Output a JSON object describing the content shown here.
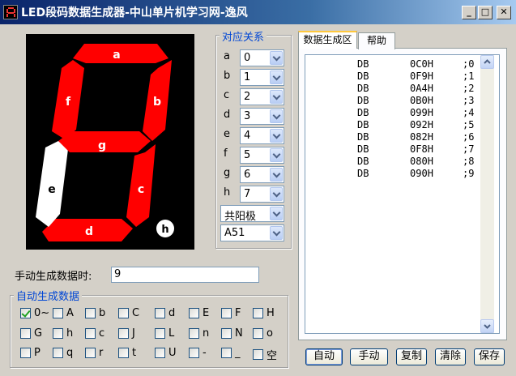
{
  "window": {
    "title": "LED段码数据生成器-中山单片机学习网-逸风",
    "controls": {
      "minimize": "_",
      "maximize": "□",
      "close": "✕"
    }
  },
  "display": {
    "segments": {
      "a": "a",
      "b": "b",
      "c": "c",
      "d": "d",
      "e": "e",
      "f": "f",
      "g": "g",
      "h": "h"
    },
    "colors": {
      "on": "#ff0000",
      "off": "#ffffff",
      "background": "#000000"
    },
    "unlit_segment": "e"
  },
  "mapping": {
    "label": "对应关系",
    "rows": [
      {
        "letter": "a",
        "value": "0"
      },
      {
        "letter": "b",
        "value": "1"
      },
      {
        "letter": "c",
        "value": "2"
      },
      {
        "letter": "d",
        "value": "3"
      },
      {
        "letter": "e",
        "value": "4"
      },
      {
        "letter": "f",
        "value": "5"
      },
      {
        "letter": "g",
        "value": "6"
      },
      {
        "letter": "h",
        "value": "7"
      }
    ],
    "type_value": "共阳极",
    "format_value": "A51"
  },
  "tabs": [
    {
      "label": "数据生成区",
      "active": true
    },
    {
      "label": "帮助",
      "active": false
    }
  ],
  "output_lines": [
    "DB       0C0H     ;0",
    "DB       0F9H     ;1",
    "DB       0A4H     ;2",
    "DB       0B0H     ;3",
    "DB       099H     ;4",
    "DB       092H     ;5",
    "DB       082H     ;6",
    "DB       0F8H     ;7",
    "DB       080H     ;8",
    "DB       090H     ;9"
  ],
  "manual": {
    "label": "手动生成数据时:",
    "value": "9"
  },
  "auto": {
    "label": "自动生成数据",
    "checkboxes": [
      {
        "label": "0~",
        "checked": true
      },
      {
        "label": "A",
        "checked": false
      },
      {
        "label": "b",
        "checked": false
      },
      {
        "label": "C",
        "checked": false
      },
      {
        "label": "d",
        "checked": false
      },
      {
        "label": "E",
        "checked": false
      },
      {
        "label": "F",
        "checked": false
      },
      {
        "label": "H",
        "checked": false
      },
      {
        "label": "G",
        "checked": false
      },
      {
        "label": "h",
        "checked": false
      },
      {
        "label": "c",
        "checked": false
      },
      {
        "label": "J",
        "checked": false
      },
      {
        "label": "L",
        "checked": false
      },
      {
        "label": "n",
        "checked": false
      },
      {
        "label": "N",
        "checked": false
      },
      {
        "label": "o",
        "checked": false
      },
      {
        "label": "P",
        "checked": false
      },
      {
        "label": "q",
        "checked": false
      },
      {
        "label": "r",
        "checked": false
      },
      {
        "label": "t",
        "checked": false
      },
      {
        "label": "U",
        "checked": false
      },
      {
        "label": "-",
        "checked": false
      },
      {
        "label": "_",
        "checked": false
      },
      {
        "label": "空",
        "checked": false
      }
    ]
  },
  "buttons": {
    "auto": "自动",
    "manual": "手动",
    "copy": "复制",
    "clear": "清除",
    "save": "保存"
  }
}
